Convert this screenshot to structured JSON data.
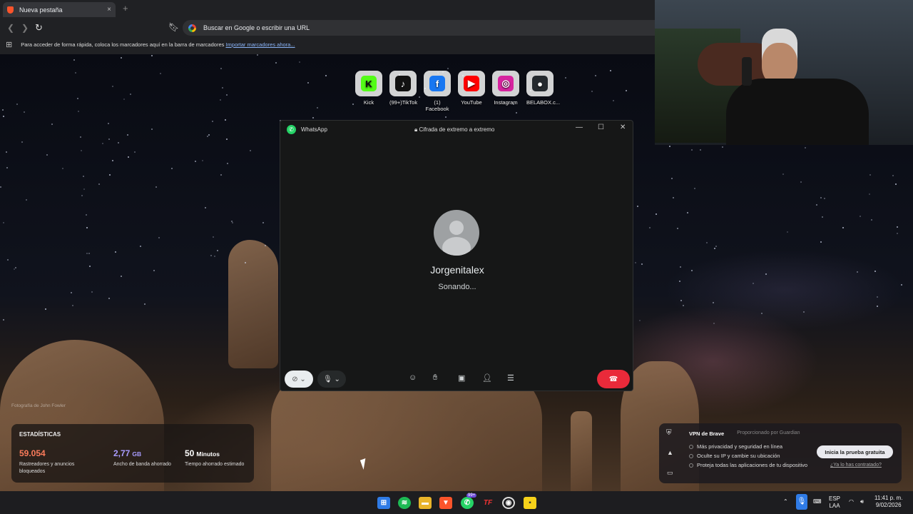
{
  "browser": {
    "tab_title": "Nueva pestaña",
    "tab_close": "×",
    "new_tab": "+",
    "address_placeholder": "Buscar en Google o escribir una URL",
    "bookmarks_text": "Para acceder de forma rápida, coloca los marcadores aquí en la barra de marcadores",
    "bookmarks_link": "Importar marcadores ahora..."
  },
  "shortcuts": [
    {
      "label": "Kick",
      "icon": "kick-icon",
      "color": "#53fc18",
      "glyph": "K"
    },
    {
      "label": "(99+)TikTok",
      "icon": "tiktok-icon",
      "color": "#111111",
      "glyph": "♪"
    },
    {
      "label": "(1) Facebook",
      "icon": "facebook-icon",
      "color": "#1877f2",
      "glyph": "f"
    },
    {
      "label": "YouTube",
      "icon": "youtube-icon",
      "color": "#ff0000",
      "glyph": "▶"
    },
    {
      "label": "Instagram",
      "icon": "instagram-icon",
      "color": "#d6249f",
      "glyph": "◎"
    },
    {
      "label": "BELABOX.c...",
      "icon": "github-icon",
      "color": "#24292e",
      "glyph": "●"
    }
  ],
  "whatsapp": {
    "app_name": "WhatsApp",
    "encryption": "Cifrada de extremo a extremo",
    "contact": "Jorgenitalex",
    "status": "Sonando..."
  },
  "stats": {
    "title": "ESTADÍSTICAS",
    "items": [
      {
        "value": "59.054",
        "unit": "",
        "label": "Rastreadores y anuncios bloqueados",
        "color": "#fb7b5b"
      },
      {
        "value": "2,77",
        "unit": "GB",
        "label": "Ancho de banda ahorrado",
        "color": "#a99cff"
      },
      {
        "value": "50",
        "unit": "Minutos",
        "label": "Tiempo ahorrado estimado",
        "color": "#ffffff"
      }
    ],
    "photo_credit": "Fotografía de John Fowler"
  },
  "vpn": {
    "title": "VPN de Brave",
    "provider": "Proporcionado por",
    "provider_name": "Guardian",
    "features": [
      "Más privacidad y seguridad en línea",
      "Oculte su IP y cambie su ubicación",
      "Proteja todas las aplicaciones de tu dispositivo"
    ],
    "cta": "Inicia la prueba gratuita",
    "link": "¿Ya lo has contratado?"
  },
  "taskbar": {
    "lang": "ESP",
    "layout": "LAA",
    "time": "11:41 p. m.",
    "date": "9/02/2026",
    "whatsapp_badge": "99+"
  },
  "colors": {
    "accent_end_call": "#ea2a3a",
    "whatsapp_green": "#25d366"
  }
}
